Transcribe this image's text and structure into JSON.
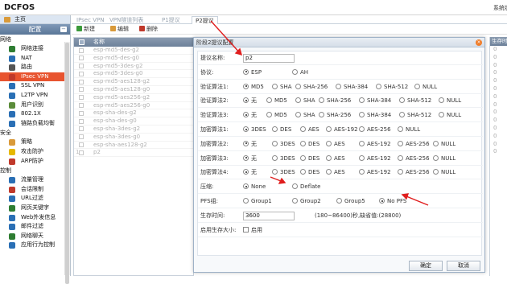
{
  "app": {
    "logo": "DCFOS",
    "system_status": "系统状"
  },
  "sidebar": {
    "home": "主页",
    "config": "配置",
    "sections": [
      {
        "label": "网络",
        "items": [
          {
            "label": "网络连接",
            "icon": "network-icon",
            "color": "#2e7d32"
          },
          {
            "label": "NAT",
            "icon": "nat-globe-icon",
            "color": "#2a6fb5"
          },
          {
            "label": "路由",
            "icon": "routing-icon",
            "color": "#555555"
          },
          {
            "label": "IPsec VPN",
            "icon": "ipsec-vpn-icon",
            "color": "#c0392b",
            "active": true
          },
          {
            "label": "SSL VPN",
            "icon": "ssl-vpn-icon",
            "color": "#2a6fb5"
          },
          {
            "label": "L2TP VPN",
            "icon": "l2tp-vpn-icon",
            "color": "#2a6fb5"
          },
          {
            "label": "用户识别",
            "icon": "user-id-icon",
            "color": "#5b8c3a"
          },
          {
            "label": "802.1X",
            "icon": "dot1x-icon",
            "color": "#2a6fb5"
          },
          {
            "label": "链路负载均衡",
            "icon": "load-balance-icon",
            "color": "#2a6fb5"
          }
        ]
      },
      {
        "label": "安全",
        "items": [
          {
            "label": "策略",
            "icon": "policy-icon",
            "color": "#d99a3a"
          },
          {
            "label": "攻击防护",
            "icon": "attack-defense-icon",
            "color": "#e6b800"
          },
          {
            "label": "ARP防护",
            "icon": "arp-defense-icon",
            "color": "#c0392b"
          }
        ]
      },
      {
        "label": "控制",
        "items": [
          {
            "label": "流量管理",
            "icon": "traffic-icon",
            "color": "#2a6fb5"
          },
          {
            "label": "会话限制",
            "icon": "session-limit-icon",
            "color": "#c0392b"
          },
          {
            "label": "URL过滤",
            "icon": "url-filter-icon",
            "color": "#2a6fb5"
          },
          {
            "label": "网页关键字",
            "icon": "web-keyword-icon",
            "color": "#2e7d32"
          },
          {
            "label": "Web外发信息",
            "icon": "web-outbound-icon",
            "color": "#2a6fb5"
          },
          {
            "label": "邮件过滤",
            "icon": "mail-filter-icon",
            "color": "#2a6fb5"
          },
          {
            "label": "网络聊天",
            "icon": "chat-icon",
            "color": "#2e7d32"
          },
          {
            "label": "应用行为控制",
            "icon": "app-control-icon",
            "color": "#2a6fb5"
          }
        ]
      }
    ]
  },
  "tabs": [
    "IPsec VPN",
    "VPN隧道列表",
    "P1提议",
    "P2提议"
  ],
  "toolbar": {
    "new": "新建",
    "edit": "编辑",
    "delete": "删除"
  },
  "grid": {
    "header_name": "名称",
    "rows": [
      {
        "num": "",
        "name": "esp-md5-des-g2"
      },
      {
        "num": "",
        "name": "esp-md5-des-g0"
      },
      {
        "num": "",
        "name": "esp-md5-3des-g2"
      },
      {
        "num": "",
        "name": "esp-md5-3des-g0"
      },
      {
        "num": "",
        "name": "esp-md5-aes128-g2"
      },
      {
        "num": "",
        "name": "esp-md5-aes128-g0"
      },
      {
        "num": "",
        "name": "esp-md5-aes256-g2"
      },
      {
        "num": "",
        "name": "esp-md5-aes256-g0"
      },
      {
        "num": "",
        "name": "esp-sha-des-g2"
      },
      {
        "num": "",
        "name": "esp-sha-des-g0"
      },
      {
        "num": "",
        "name": "esp-sha-3des-g2"
      },
      {
        "num": "",
        "name": "esp-sha-3des-g0"
      },
      {
        "num": "",
        "name": "esp-sha-aes128-g2"
      },
      {
        "num": "1",
        "name": "p2"
      }
    ],
    "right_header": "生存时",
    "right_values": [
      "0",
      "0",
      "0",
      "0",
      "0",
      "0",
      "0",
      "0",
      "0",
      "0",
      "0",
      "0",
      "0",
      "0"
    ]
  },
  "dialog": {
    "title": "阶段2提议配置",
    "fields": {
      "name_label": "提议名称:",
      "name_value": "p2",
      "protocol_label": "协议:",
      "protocol_options": [
        "ESP",
        "AH"
      ],
      "auth1_label": "验证算法1:",
      "auth1_options": [
        "MD5",
        "SHA",
        "SHA-256",
        "SHA-384",
        "SHA-512",
        "NULL"
      ],
      "auth2_label": "验证算法2:",
      "auth2_options": [
        "无",
        "MD5",
        "SHA",
        "SHA-256",
        "SHA-384",
        "SHA-512",
        "NULL"
      ],
      "auth3_label": "验证算法3:",
      "auth3_options": [
        "无",
        "MD5",
        "SHA",
        "SHA-256",
        "SHA-384",
        "SHA-512",
        "NULL"
      ],
      "enc1_label": "加密算法1:",
      "enc1_options": [
        "3DES",
        "DES",
        "AES",
        "AES-192",
        "AES-256",
        "NULL"
      ],
      "enc2_label": "加密算法2:",
      "enc2_options": [
        "无",
        "3DES",
        "DES",
        "AES",
        "AES-192",
        "AES-256",
        "NULL"
      ],
      "enc3_label": "加密算法3:",
      "enc3_options": [
        "无",
        "3DES",
        "DES",
        "AES",
        "AES-192",
        "AES-256",
        "NULL"
      ],
      "enc4_label": "加密算法4:",
      "enc4_options": [
        "无",
        "3DES",
        "DES",
        "AES",
        "AES-192",
        "AES-256",
        "NULL"
      ],
      "compress_label": "压缩:",
      "compress_options": [
        "None",
        "Deflate"
      ],
      "pfs_label": "PFS组:",
      "pfs_options": [
        "Group1",
        "Group2",
        "Group5",
        "No PFS"
      ],
      "lifetime_label": "生存时间:",
      "lifetime_value": "3600",
      "lifetime_hint": "(180~86400)秒,缺省值:(28800)",
      "lifesize_label": "启用生存大小:",
      "lifesize_option": "启用"
    },
    "ok": "确定",
    "cancel": "取消"
  },
  "colors": {
    "accent": "#e8542f",
    "header": "#6d819a",
    "arrow": "#e01e1e"
  }
}
